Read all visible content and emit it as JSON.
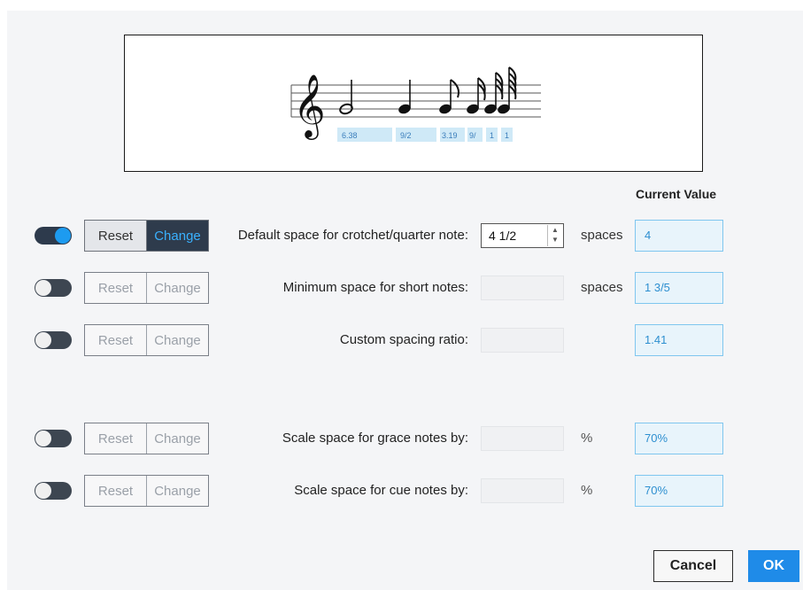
{
  "preview": {
    "spacing_labels": [
      "6.38",
      "9/2",
      "3.19",
      "9/",
      "1",
      "1"
    ]
  },
  "current_value_header": "Current Value",
  "rows": [
    {
      "reset_label": "Reset",
      "change_label": "Change",
      "label": "Default space for crotchet/quarter note:",
      "input_value": "4 1/2",
      "unit": "spaces",
      "current_value": "4",
      "toggle_on": true
    },
    {
      "reset_label": "Reset",
      "change_label": "Change",
      "label": "Minimum space for short notes:",
      "input_value": "",
      "unit": "spaces",
      "current_value": "1 3/5",
      "toggle_on": false
    },
    {
      "reset_label": "Reset",
      "change_label": "Change",
      "label": "Custom spacing ratio:",
      "input_value": "",
      "unit": "",
      "current_value": "1.41",
      "toggle_on": false
    },
    {
      "reset_label": "Reset",
      "change_label": "Change",
      "label": "Scale space for grace notes by:",
      "input_value": "",
      "unit": "%",
      "current_value": "70%",
      "toggle_on": false
    },
    {
      "reset_label": "Reset",
      "change_label": "Change",
      "label": "Scale space for cue notes by:",
      "input_value": "",
      "unit": "%",
      "current_value": "70%",
      "toggle_on": false
    }
  ],
  "footer": {
    "cancel_label": "Cancel",
    "ok_label": "OK"
  },
  "colors": {
    "accent": "#1f8be8",
    "active_toggle": "#1d9bf0",
    "change_active_bg": "#2e3b4c",
    "current_value_border": "#7fc6ef"
  }
}
